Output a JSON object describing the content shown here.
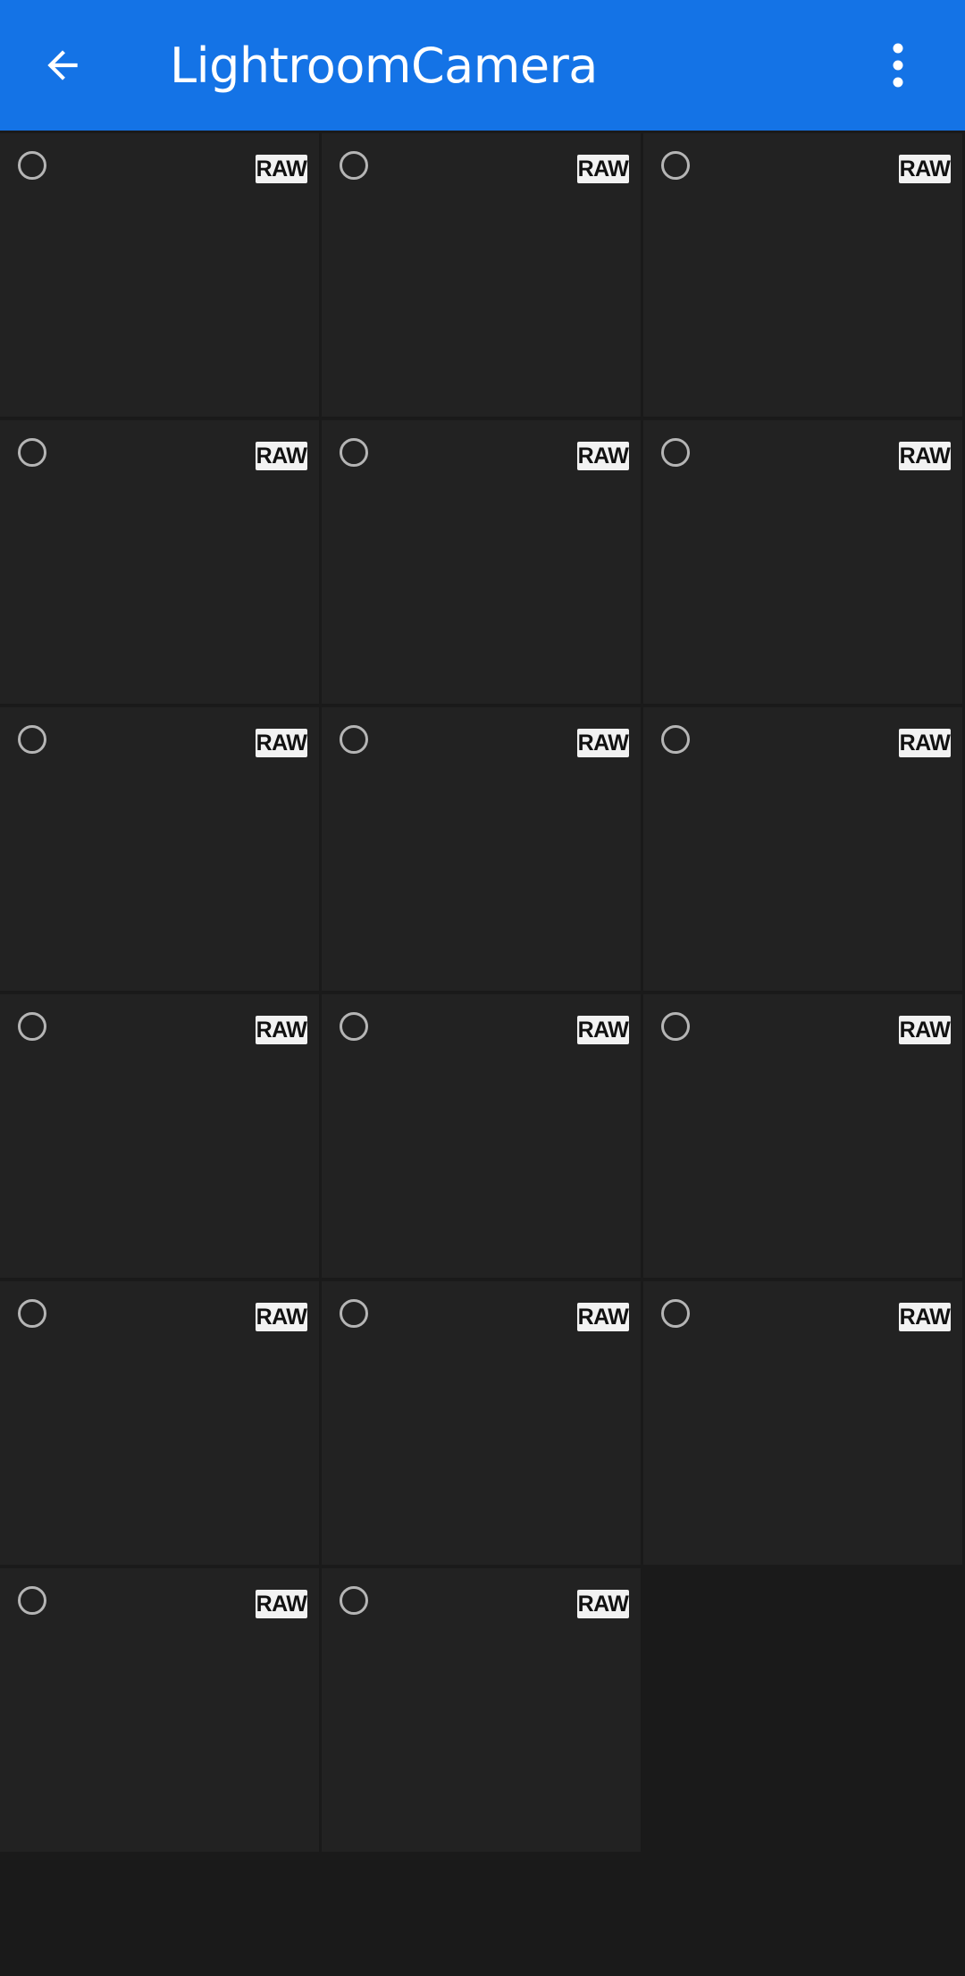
{
  "app_bar": {
    "title": "LightroomCamera",
    "back_icon": "arrow-back-icon",
    "menu_icon": "more-vertical-icon",
    "background_color": "#1473e6"
  },
  "grid": {
    "photos": [
      {
        "badge": "RAW",
        "selected": false
      },
      {
        "badge": "RAW",
        "selected": false
      },
      {
        "badge": "RAW",
        "selected": false
      },
      {
        "badge": "RAW",
        "selected": false
      },
      {
        "badge": "RAW",
        "selected": false
      },
      {
        "badge": "RAW",
        "selected": false
      },
      {
        "badge": "RAW",
        "selected": false
      },
      {
        "badge": "RAW",
        "selected": false
      },
      {
        "badge": "RAW",
        "selected": false
      },
      {
        "badge": "RAW",
        "selected": false
      },
      {
        "badge": "RAW",
        "selected": false
      },
      {
        "badge": "RAW",
        "selected": false
      },
      {
        "badge": "RAW",
        "selected": false
      },
      {
        "badge": "RAW",
        "selected": false
      },
      {
        "badge": "RAW",
        "selected": false
      },
      {
        "badge": "RAW",
        "selected": false
      },
      {
        "badge": "RAW",
        "selected": false
      }
    ]
  }
}
